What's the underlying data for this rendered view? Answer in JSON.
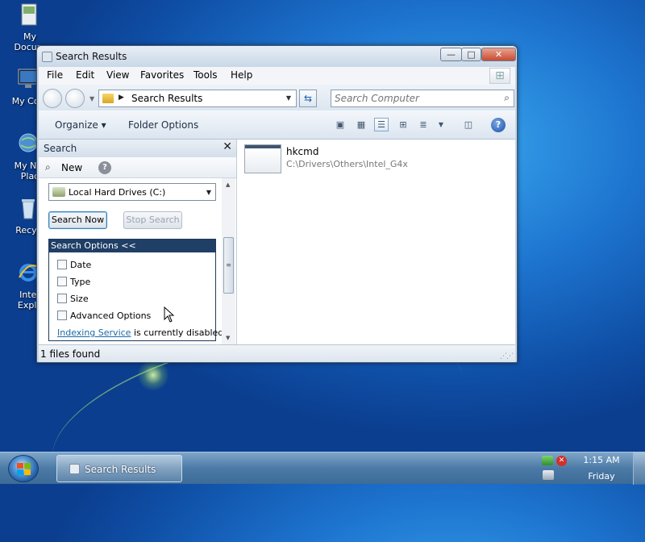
{
  "desktop": {
    "icons": [
      {
        "name": "my-documents",
        "label": "My\nDocum",
        "icon": "documents-icon"
      },
      {
        "name": "my-computer",
        "label": "My Com",
        "icon": "computer-icon"
      },
      {
        "name": "my-network-places",
        "label": "My Net\nPlac",
        "icon": "network-icon"
      },
      {
        "name": "recycle-bin",
        "label": "Recycl",
        "icon": "recycle-bin-icon"
      },
      {
        "name": "internet-explorer",
        "label": "Inter\nExplo",
        "icon": "internet-explorer-icon"
      }
    ]
  },
  "window": {
    "title": "Search Results",
    "controls": {
      "minimize": "—",
      "maximize": "□",
      "close": "✕"
    },
    "menu": [
      "File",
      "Edit",
      "View",
      "Favorites",
      "Tools",
      "Help"
    ],
    "address": {
      "text": "Search Results"
    },
    "search": {
      "placeholder": "Search Computer"
    },
    "commands": {
      "organize": "Organize ▾",
      "folder_options": "Folder Options"
    }
  },
  "search_pane": {
    "title": "Search",
    "close_glyph": "✕",
    "new_label": "New",
    "drive_selected": "Local Hard Drives (C:)",
    "search_now": "Search Now",
    "stop_search": "Stop Search",
    "options_header": "Search Options <<",
    "options": [
      {
        "label": "Date",
        "checked": false
      },
      {
        "label": "Type",
        "checked": false
      },
      {
        "label": "Size",
        "checked": false
      },
      {
        "label": "Advanced Options",
        "checked": false
      }
    ],
    "indexing_link": "Indexing Service",
    "indexing_text": " is currently disabled."
  },
  "results": {
    "items": [
      {
        "name": "hkcmd",
        "path": "C:\\Drivers\\Others\\Intel_G4x"
      }
    ]
  },
  "status": {
    "text": "1 files found"
  },
  "taskbar": {
    "task_label": "Search Results",
    "clock_time": "1:15 AM",
    "clock_day": "Friday"
  }
}
